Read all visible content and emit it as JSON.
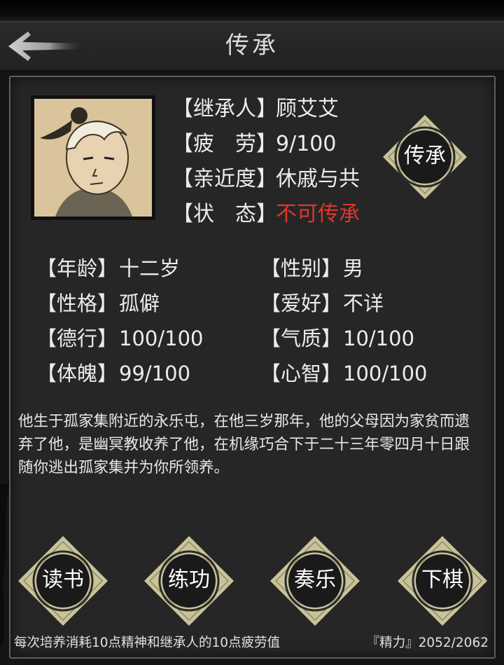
{
  "header": {
    "title": "传承",
    "back_icon": "back-arrow-icon"
  },
  "heir": {
    "portrait_icon": "heir-portrait",
    "heir_label": "【继承人】",
    "heir_value": "顾艾艾",
    "fatigue_label": "【疲　劳】",
    "fatigue_value": "9/100",
    "closeness_label": "【亲近度】",
    "closeness_value": "休戚与共",
    "status_label": "【状　态】",
    "status_value": "不可传承",
    "status_color": "#e0362b"
  },
  "inherit_button": {
    "label": "传承"
  },
  "attributes": {
    "age_label": "【年龄】",
    "age_value": "十二岁",
    "gender_label": "【性别】",
    "gender_value": "男",
    "personality_label": "【性格】",
    "personality_value": "孤僻",
    "hobby_label": "【爱好】",
    "hobby_value": "不详",
    "virtue_label": "【德行】",
    "virtue_value": "100/100",
    "temperament_label": "【气质】",
    "temperament_value": "10/100",
    "physique_label": "【体魄】",
    "physique_value": "99/100",
    "wisdom_label": "【心智】",
    "wisdom_value": "100/100"
  },
  "description": "他生于孤家集附近的永乐屯，在他三岁那年，他的父母因为家贫而遗弃了他，是幽冥教收养了他，在机缘巧合下于二十三年零四月十日跟随你逃出孤家集并为你所领养。",
  "actions": [
    {
      "label": "读书"
    },
    {
      "label": "练功"
    },
    {
      "label": "奏乐"
    },
    {
      "label": "下棋"
    }
  ],
  "footer": {
    "hint": "每次培养消耗10点精神和继承人的10点疲劳值",
    "energy": "『精力』2052/2062"
  }
}
